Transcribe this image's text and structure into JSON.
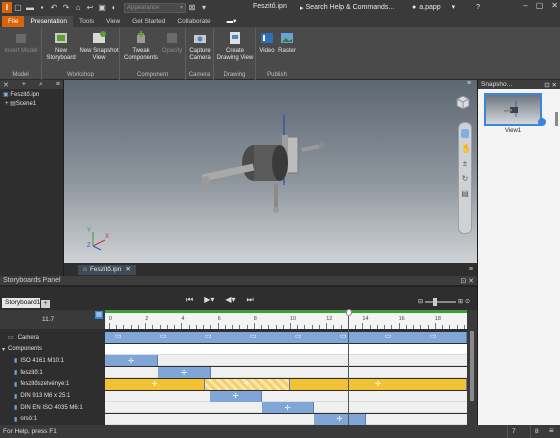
{
  "titlebar": {
    "appearance_placeholder": "Appearance",
    "doc_title": "Feszitő.ipn",
    "search": "Search Help & Commands...",
    "user": "a.papp",
    "help": "?"
  },
  "tabs": [
    "File",
    "Presentation",
    "Tools",
    "View",
    "Get Started",
    "Collaborate"
  ],
  "ribbon": {
    "groups": [
      {
        "label": "Model",
        "buttons": [
          {
            "label": "Insert Model",
            "disabled": true
          }
        ]
      },
      {
        "label": "Workshop",
        "buttons": [
          {
            "label": "New Storyboard"
          },
          {
            "label": "New Snapshot View"
          }
        ]
      },
      {
        "label": "Component",
        "buttons": [
          {
            "label": "Tweak Components"
          },
          {
            "label": "Opacity",
            "disabled": true
          }
        ]
      },
      {
        "label": "Camera",
        "buttons": [
          {
            "label": "Capture Camera"
          }
        ]
      },
      {
        "label": "Drawing",
        "buttons": [
          {
            "label": "Create Drawing View"
          }
        ]
      },
      {
        "label": "Publish",
        "buttons": [
          {
            "label": "Video"
          },
          {
            "label": "Raster"
          }
        ]
      }
    ]
  },
  "browser": {
    "root": "Feszitő.ipn",
    "scene": "Scene1"
  },
  "viewport_tab": "Feszitő.ipn",
  "axis": {
    "x": "X",
    "y": "Y",
    "z": "Z"
  },
  "snapshot": {
    "title": "Snapsho...",
    "view_label": "View1"
  },
  "storyboard": {
    "panel_title": "Storyboards Panel",
    "tab": "Storyboard1",
    "time": "11.7",
    "ruler_labels": [
      "0",
      "2",
      "4",
      "6",
      "8",
      "10",
      "12",
      "14",
      "16",
      "18"
    ],
    "rows": [
      {
        "label": "Camera",
        "type": "camera"
      },
      {
        "label": "Components",
        "type": "group"
      },
      {
        "label": "ISO 4161 M10:1",
        "type": "component"
      },
      {
        "label": "feszitő:1",
        "type": "component"
      },
      {
        "label": "feszitőszelvénye:1",
        "type": "component"
      },
      {
        "label": "DIN 913 M6 x 25:1",
        "type": "component"
      },
      {
        "label": "DIN EN ISO 4035 M6:1",
        "type": "component"
      },
      {
        "label": "orsó:1",
        "type": "component"
      }
    ]
  },
  "status": {
    "text": "For Help, press F1",
    "count1": "7",
    "count2": "8"
  },
  "colors": {
    "file_tab": "#d8640a",
    "track_blue": "#7fa6d6",
    "track_yellow": "#f2c232",
    "playhead": "#555555"
  }
}
